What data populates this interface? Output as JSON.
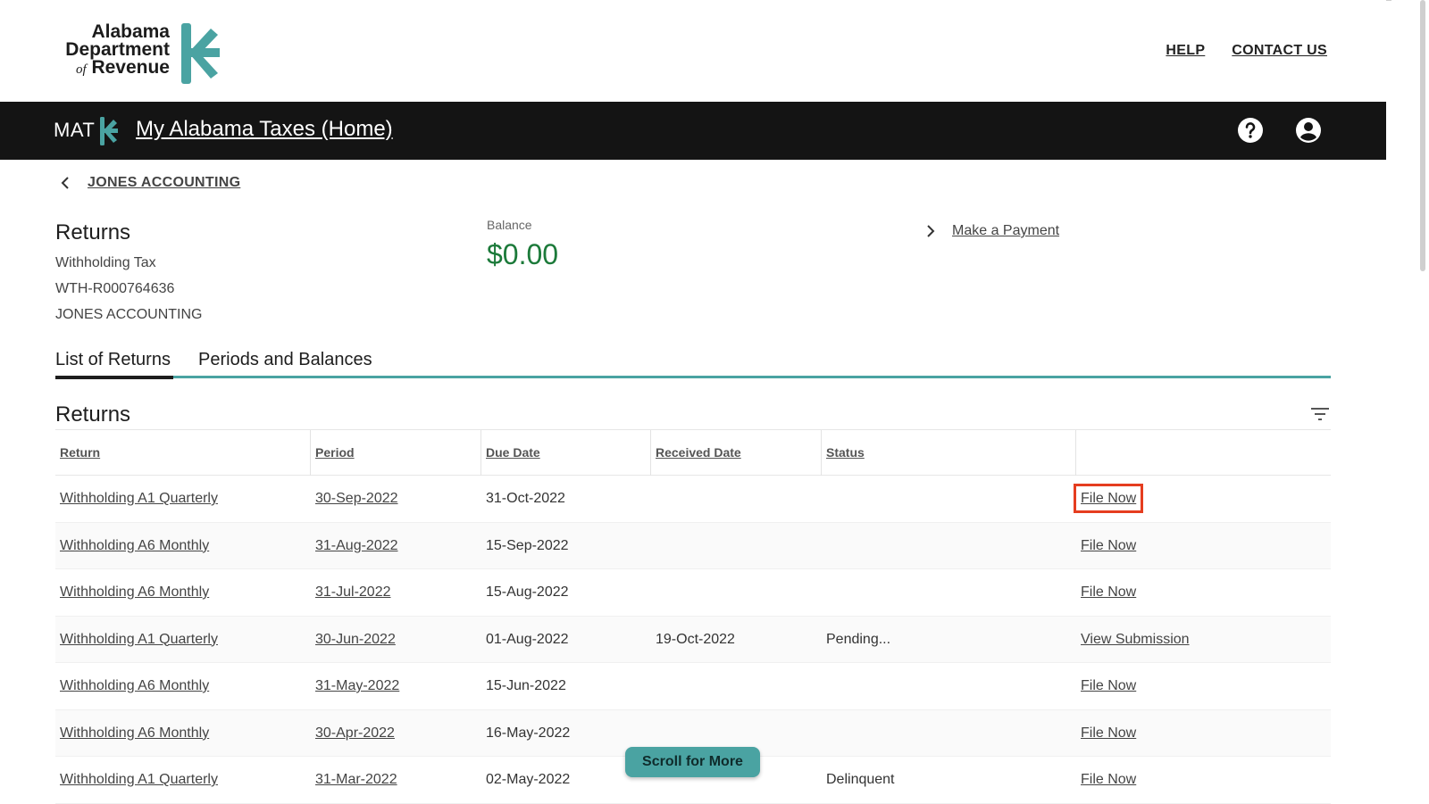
{
  "header": {
    "logo": {
      "line1": "Alabama",
      "line2": "Department",
      "line3_of": "of",
      "line3": "Revenue"
    },
    "links": {
      "help": "HELP",
      "contact": "CONTACT US"
    }
  },
  "navbar": {
    "brand": "MAT",
    "home_link": "My Alabama Taxes (Home)"
  },
  "breadcrumb": {
    "label": "JONES ACCOUNTING"
  },
  "summary": {
    "title": "Returns",
    "tax_type": "Withholding Tax",
    "account_id": "WTH-R000764636",
    "account_name": "JONES ACCOUNTING",
    "balance_label": "Balance",
    "balance_value": "$0.00",
    "payment_link": "Make a Payment"
  },
  "tabs": [
    {
      "label": "List of Returns",
      "active": true
    },
    {
      "label": "Periods and Balances",
      "active": false
    }
  ],
  "returns": {
    "title": "Returns",
    "columns": {
      "return": "Return",
      "period": "Period",
      "due_date": "Due Date",
      "received_date": "Received Date",
      "status": "Status"
    },
    "rows": [
      {
        "return": "Withholding A1 Quarterly",
        "period": "30-Sep-2022",
        "due": "31-Oct-2022",
        "received": "",
        "status": "",
        "action": "File Now"
      },
      {
        "return": "Withholding A6 Monthly",
        "period": "31-Aug-2022",
        "due": "15-Sep-2022",
        "received": "",
        "status": "",
        "action": "File Now"
      },
      {
        "return": "Withholding A6 Monthly",
        "period": "31-Jul-2022",
        "due": "15-Aug-2022",
        "received": "",
        "status": "",
        "action": "File Now"
      },
      {
        "return": "Withholding A1 Quarterly",
        "period": "30-Jun-2022",
        "due": "01-Aug-2022",
        "received": "19-Oct-2022",
        "status": "Pending...",
        "action": "View Submission"
      },
      {
        "return": "Withholding A6 Monthly",
        "period": "31-May-2022",
        "due": "15-Jun-2022",
        "received": "",
        "status": "",
        "action": "File Now"
      },
      {
        "return": "Withholding A6 Monthly",
        "period": "30-Apr-2022",
        "due": "16-May-2022",
        "received": "",
        "status": "",
        "action": "File Now"
      },
      {
        "return": "Withholding A1 Quarterly",
        "period": "31-Mar-2022",
        "due": "02-May-2022",
        "received": "",
        "status": "Delinquent",
        "action": "File Now"
      }
    ]
  },
  "scroll_more": "Scroll for More",
  "colors": {
    "accent": "#4aa3a2",
    "balance": "#1c7a3a",
    "navbar": "#141414",
    "highlight": "#e53d1f"
  }
}
